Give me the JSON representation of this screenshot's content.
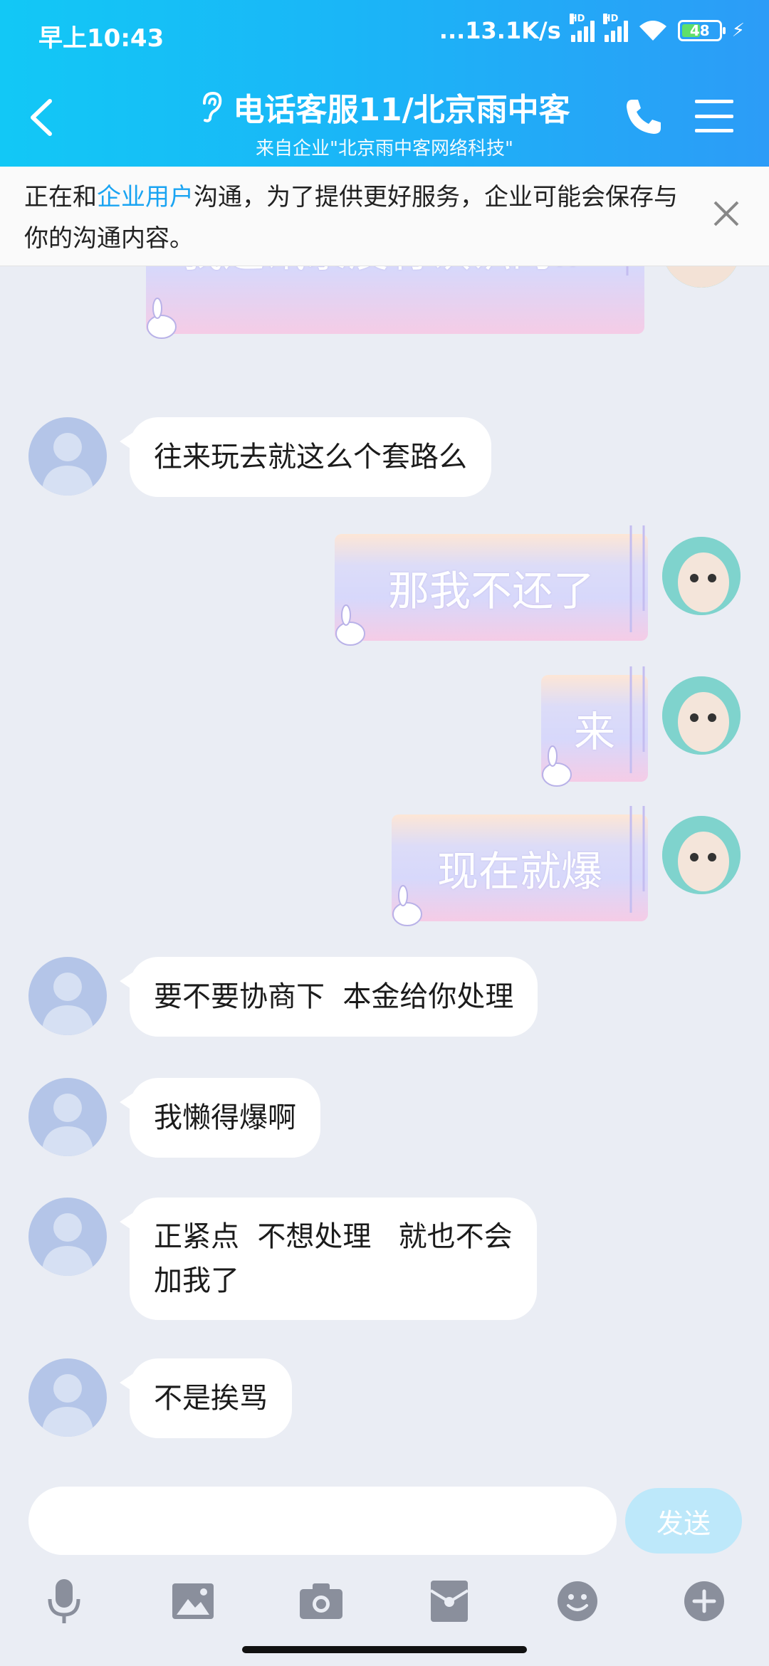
{
  "status_bar": {
    "time": "早上10:43",
    "network_speed": "...13.1K/s",
    "signal_label": "HD",
    "battery": "48"
  },
  "header": {
    "title": "电话客服11/北京雨中客",
    "subtitle": "来自企业\"北京雨中客网络科技\"",
    "icons": [
      "back-icon",
      "ear-icon",
      "phone-icon",
      "menu-icon"
    ]
  },
  "notice": {
    "prefix": "正在和",
    "highlight": "企业用户",
    "suffix": "沟通，为了提供更好服务，企业可能会保存与你的沟通内容。"
  },
  "messages": [
    {
      "side": "right",
      "text": "我通讯录没有认识的..",
      "style": "sticker-bubble"
    },
    {
      "side": "left",
      "text": "往来玩去就这么个套路么"
    },
    {
      "side": "right",
      "text": "那我不还了",
      "style": "sticker-bubble"
    },
    {
      "side": "right",
      "text": "来",
      "style": "sticker-bubble"
    },
    {
      "side": "right",
      "text": "现在就爆",
      "style": "sticker-bubble"
    },
    {
      "side": "left",
      "text": "要不要协商下  本金给你处理"
    },
    {
      "side": "left",
      "text": "我懒得爆啊"
    },
    {
      "side": "left",
      "lines": [
        "正紧点  不想处理   就也不会",
        "加我了"
      ]
    },
    {
      "side": "left",
      "text": "不是挨骂"
    }
  ],
  "input": {
    "placeholder": "",
    "send_label": "发送"
  },
  "toolbar": [
    "microphone-icon",
    "image-icon",
    "camera-icon",
    "red-packet-icon",
    "emoji-icon",
    "plus-icon"
  ],
  "colors": {
    "header_start": "#12c8f6",
    "header_end": "#2c9cf7",
    "highlight": "#1aa4f2",
    "chat_bg": "#eaedf4",
    "send_disabled": "#bde8fa"
  }
}
